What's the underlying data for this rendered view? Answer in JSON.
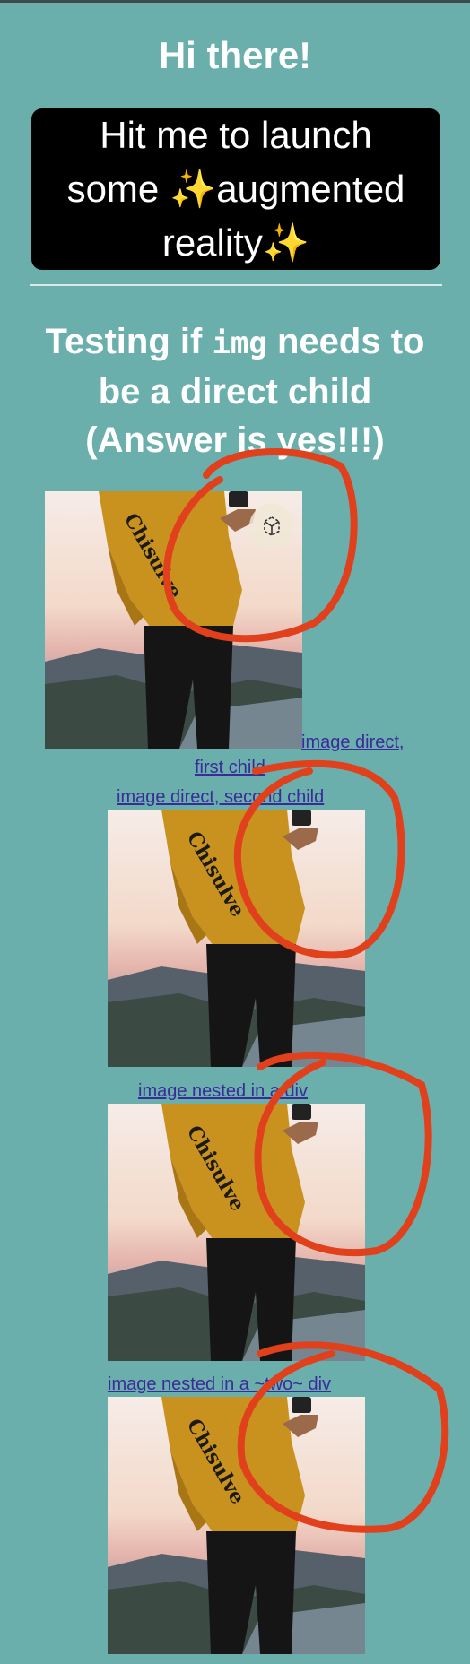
{
  "page": {
    "title": "Hi there!",
    "ar_button": {
      "line1": "Hit me to launch",
      "line2": "some ✨augmented",
      "line3": "reality✨"
    },
    "subtitle": {
      "part1": "Testing if ",
      "code": "img",
      "part2": " needs to be a direct child",
      "answer": "(Answer is yes!!!)"
    }
  },
  "examples": [
    {
      "link1": " image direct,",
      "link2": "first child"
    },
    {
      "link": "image direct, second child"
    },
    {
      "link": "image nested in a div"
    },
    {
      "link": "image nested in a ~two~ div"
    }
  ],
  "icons": {
    "ar_badge": "ar-cube-icon"
  },
  "colors": {
    "background": "#6aafac",
    "button": "#000000",
    "link": "#3b2b9a",
    "annotation": "#e0401c"
  }
}
